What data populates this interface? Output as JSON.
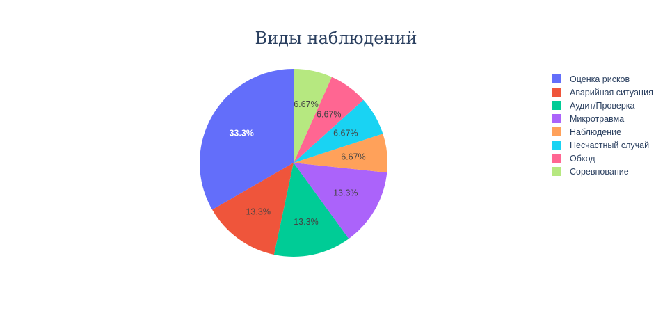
{
  "chart_data": {
    "type": "pie",
    "title": "Виды наблюдений",
    "categories": [
      "Оценка рисков",
      "Аварийная ситуация",
      "Аудит/Проверка",
      "Микротравма",
      "Наблюдение",
      "Несчастный случай",
      "Обход",
      "Соревнование"
    ],
    "values": [
      5,
      2,
      2,
      2,
      1,
      1,
      1,
      1
    ],
    "labels": [
      "33.3%",
      "13.3%",
      "13.3%",
      "13.3%",
      "6.67%",
      "6.67%",
      "6.67%",
      "6.67%"
    ],
    "colors": [
      "#636efa",
      "#EF553B",
      "#00cc96",
      "#ab63fa",
      "#FFA15A",
      "#19d3f3",
      "#FF6692",
      "#B6E880"
    ],
    "label_colors": [
      "#ffffff",
      "#444444",
      "#444444",
      "#444444",
      "#444444",
      "#444444",
      "#444444",
      "#444444"
    ],
    "direction": "counterclockwise",
    "legend_position": "right"
  }
}
